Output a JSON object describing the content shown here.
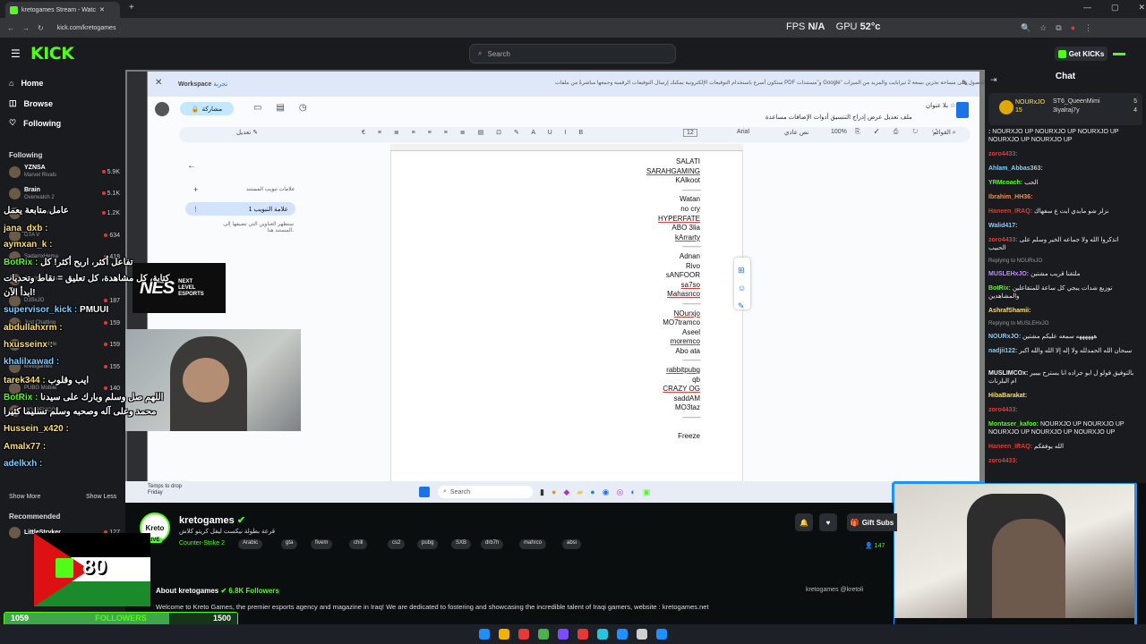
{
  "browser": {
    "tab_title": "kretogames Stream - Watc",
    "url": "kick.com/kretogames"
  },
  "hud": {
    "fps_label": "FPS",
    "fps_value": "N/A",
    "gpu_label": "GPU",
    "gpu_value": "52",
    "gpu_unit": "°c"
  },
  "header": {
    "logo": "KICK",
    "search_placeholder": "Search",
    "get_kicks": "Get KICKs"
  },
  "nav": {
    "home": "Home",
    "browse": "Browse",
    "following": "Following"
  },
  "sidebar": {
    "following_title": "Following",
    "channels": [
      {
        "name": "YZNSA",
        "game": "Marvel Rivals",
        "count": "5.9K"
      },
      {
        "name": "Brain",
        "game": "Overwatch 2",
        "count": "5.1K"
      },
      {
        "name": "",
        "game": "PUBG Mobile",
        "count": "1.2K"
      },
      {
        "name": "",
        "game": "GTA V",
        "count": "634"
      },
      {
        "name": "",
        "game": "SadamxHema",
        "count": "418"
      },
      {
        "name": "",
        "game": "Counter-Strike 2",
        "count": "285"
      },
      {
        "name": "",
        "game": "D3SxJO",
        "count": "187"
      },
      {
        "name": "",
        "game": "Just Chatting",
        "count": "159"
      },
      {
        "name": "",
        "game": "PUBG Mobile",
        "count": "159"
      },
      {
        "name": "",
        "game": "kretogames",
        "count": "155"
      },
      {
        "name": "",
        "game": "PUBG Mobile",
        "count": "140"
      },
      {
        "name": "",
        "game": "MOJREMCO",
        "count": ""
      }
    ],
    "show_more": "Show More",
    "show_less": "Show Less",
    "recommended_title": "Recommended",
    "recommended": [
      {
        "name": "LittleStryker",
        "count": "127"
      }
    ]
  },
  "docs": {
    "workspace": "Workspace",
    "workspace_sub": "تجربة",
    "banner": "ستكون أسرع باستخدام التوقيعات الإلكترونية  يمكنك إرسال التوقيعات الرقمية وجمعها مباشرةً من ملفات PDF و\"مستندات Google\" والحصول على مساحة تخزين بسعة 2 تيرابايت والمزيد من الميزات.",
    "share": "مشاركة",
    "title": "بلا عنوان",
    "menus": "ملف  تعديل  عرض  إدراج  التنسيق  أدوات  الإضافات  مساعدة",
    "toolbar": {
      "menus": "القوائم",
      "zoom": "100%",
      "style": "نص عادي",
      "font": "Arial",
      "size": "12",
      "edit": "تعديل"
    },
    "outline_tab": "علامات تبويب المستند",
    "outline_item": "علامة التبويب 1",
    "outline_hint": "ستظهر العناوين التي تضيفها إلى المستند هنا.",
    "lines": [
      "SALATI",
      "SARAHGAMING",
      "KAlkoot",
      "------------",
      "Watan",
      "no cry",
      "HYPERFATE",
      "ABO 3lia",
      "kArrarty",
      "------------",
      "Adnan",
      "Rivo",
      "sANFOOR",
      "sa7so",
      "Mahasnco",
      "------------",
      "NOurxjo",
      "MO7tramco",
      "Aseel",
      "moremco",
      "Abo ata",
      "------------",
      "rabbitpubg",
      "qb",
      "CRAZY OG",
      "saddAM",
      "MO3taz",
      "------------",
      "",
      "Freeze"
    ]
  },
  "win": {
    "search": "Search",
    "temp_drop": "Temps to drop",
    "temp_day": "Friday"
  },
  "nes": {
    "big": "NES",
    "small1": "NEXT",
    "small2": "LEVEL",
    "small3": "ESPORTS"
  },
  "overlay_chat": [
    {
      "user": "",
      "msg": "عامل متابعة يعمل"
    },
    {
      "user": "jana_dxb",
      "msg": ""
    },
    {
      "user": "aymxan_k",
      "msg": ""
    },
    {
      "user": "BotRix",
      "msg": "تفاعل أكثر، اربح أكثر! كل"
    },
    {
      "user": "",
      "msg": "كتابة، كل مشاهدة، كل تعليق = نقاط وتحديات"
    },
    {
      "user": "",
      "msg": "ابدأ الآن!"
    },
    {
      "user": "supervisor_kick",
      "msg": "PMUUI"
    },
    {
      "user": "abdullahxrm",
      "msg": ""
    },
    {
      "user": "hxusseinx",
      "msg": ""
    },
    {
      "user": "khalilxawad",
      "msg": ""
    },
    {
      "user": "tarek344",
      "msg": "ايب وقلوب"
    },
    {
      "user": "BotRix",
      "msg": "اللهم صل وسلم وبارك على سيدنا"
    },
    {
      "user": "",
      "msg": "محمد وعلى آله وصحبه وسلم تسليما كثيرا"
    },
    {
      "user": "Hussein_x420",
      "msg": ""
    },
    {
      "user": "Amalx77",
      "msg": ""
    },
    {
      "user": "adelkxh",
      "msg": ""
    }
  ],
  "stream": {
    "channel": "kretogames",
    "title": "قرعة بطولة نيكست ليفل كريتو كلاش",
    "category": "Counter-Strike 2",
    "tags": [
      "Arabic",
      "gta",
      "fivem",
      "chill",
      "cs2",
      "pubg",
      "SXB",
      "drb7h",
      "mahrco",
      "absi"
    ],
    "gift_subs": "Gift Subs",
    "viewers": "147",
    "about_title": "About kretogames",
    "followers": "6.8K Followers",
    "about": "Welcome to Kreto Games, the premier esports agency and magazine in Iraq! We are dedicated to fostering and showcasing the incredible talent of Iraqi gamers, website : kretogames.net",
    "socials": "kretogames   @kretoli"
  },
  "goal": {
    "current": "1059",
    "label": "FOLLOWERS",
    "target": "1500",
    "big": "80",
    "progress": 0.706
  },
  "chat": {
    "title": "Chat",
    "pinned": [
      {
        "user": "NOURxJO",
        "count": "15"
      },
      {
        "user": "ST6_QueenMimi",
        "count": "5"
      },
      {
        "user": "3iyalraj7y",
        "count": "4"
      }
    ],
    "messages": [
      {
        "user": "",
        "msg": "NOURXJO UP NOURXJO UP NOURXJO UP NOURXJO UP NOURXJO UP",
        "color": "#eee"
      },
      {
        "user": "zoro4433",
        "msg": "",
        "color": "#e53935"
      },
      {
        "user": "Ahlam_Abbas363",
        "msg": "",
        "color": "#7fd0ff"
      },
      {
        "user": "YRMcoach",
        "msg": "الحب",
        "color": "#53fc18"
      },
      {
        "user": "Ibrahim_HH36",
        "msg": "",
        "color": "#ff8a3d"
      },
      {
        "user": "Haneen_IRAQ",
        "msg": "نزلز شو مايدي ايت ع سفهاك",
        "color": "#e53935"
      },
      {
        "user": "Walid417",
        "msg": "",
        "color": "#7fd0ff"
      },
      {
        "user": "zoro4433",
        "msg": "اتذكروا الله ولا جماعه الخير وسلم على الحبيب",
        "color": "#e53935"
      },
      {
        "user": "Replying to NOURxJO",
        "msg": "",
        "color": "#999"
      },
      {
        "user": "MUSLEHxJO",
        "msg": "ملتفنا قريب مشتين",
        "color": "#c08cff"
      },
      {
        "user": "BotRix",
        "msg": "توزيع شدات يبجي كل ساعة للمتفاعلين والمشاهدين",
        "color": "#53fc18"
      },
      {
        "user": "AshrafShamii",
        "msg": "",
        "color": "#ffe05a"
      },
      {
        "user": "Replying to MUSLEHxJO",
        "msg": "",
        "color": "#999"
      },
      {
        "user": "NOURxJO",
        "msg": "ههههههه سمعه عليكم مشتين",
        "color": "#7fd0ff"
      },
      {
        "user": "nadjii122",
        "msg": "سبحان الله الحمدلله ولا إله إلا الله والله اكبر",
        "color": "#7fd0ff"
      },
      {
        "user": "MUSLIMCOx",
        "msg": "بالتوفيق قولو ل ابو جراده انا يسترح بيبير ام البلزنات",
        "color": "#eee"
      },
      {
        "user": "HibaBarakat",
        "msg": "",
        "color": "#ffe05a"
      },
      {
        "user": "zoro4433",
        "msg": "",
        "color": "#e53935"
      },
      {
        "user": "Montaser_kafoo",
        "msg": "NOURXJO UP NOURXJO UP NOURXJO UP NOURXJO UP NOURXJO UP",
        "color": "#53fc18"
      },
      {
        "user": "Haneen_IRAQ",
        "msg": "الله يوفقكم",
        "color": "#e53935"
      },
      {
        "user": "zoro4433",
        "msg": "",
        "color": "#e53935"
      }
    ]
  }
}
